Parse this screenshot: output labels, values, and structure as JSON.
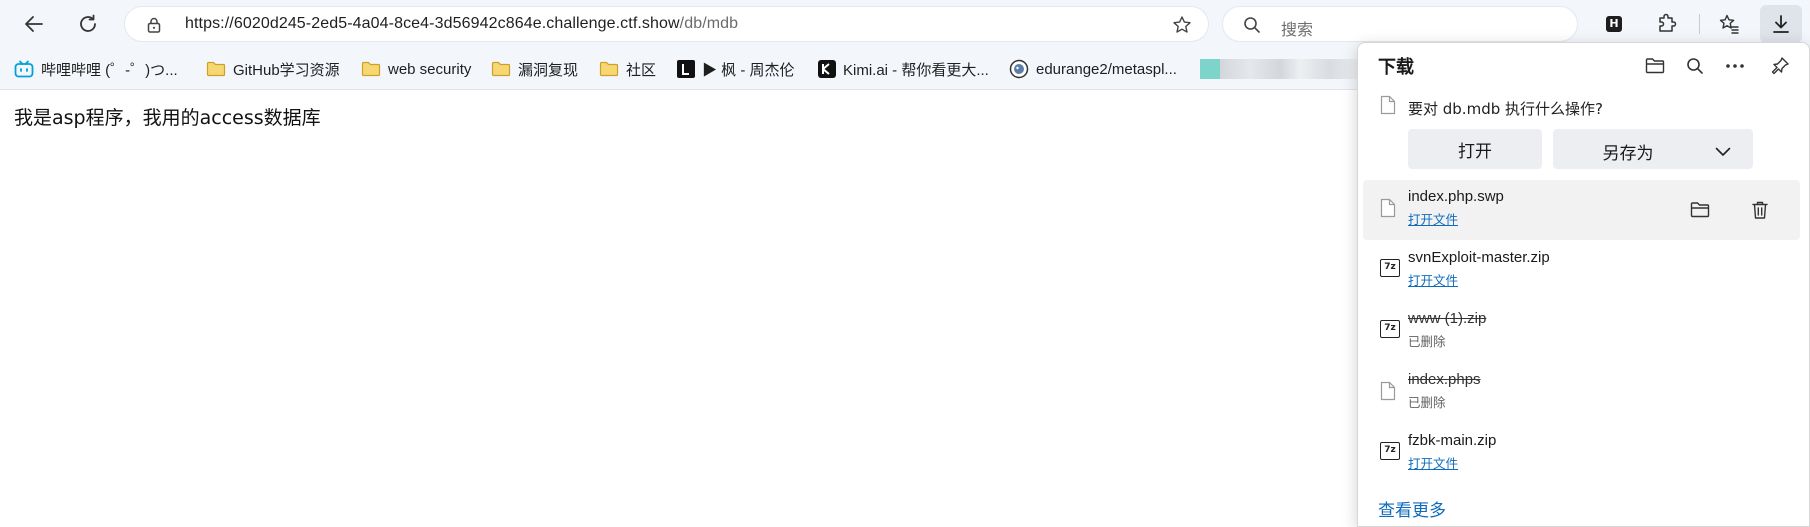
{
  "toolbar": {
    "url_main": "https://6020d245-2ed5-4a04-8ce4-3d56942c864e.challenge.ctf.show",
    "url_path": "/db/mdb",
    "search_placeholder": "搜索",
    "ext_h_label": "H"
  },
  "bookmarks": [
    {
      "label": "哔哩哔哩 (゜-゜)つ...",
      "icon": "bilibili-icon"
    },
    {
      "label": "GitHub学习资源",
      "icon": "folder-icon"
    },
    {
      "label": "web security",
      "icon": "folder-icon"
    },
    {
      "label": "漏洞复现",
      "icon": "folder-icon"
    },
    {
      "label": "社区",
      "icon": "folder-icon"
    },
    {
      "label": "▶ 枫 - 周杰伦",
      "icon": "music-app-icon"
    },
    {
      "label": "Kimi.ai - 帮你看更大...",
      "icon": "kimi-icon"
    },
    {
      "label": "edurange2/metaspl...",
      "icon": "github-icon"
    }
  ],
  "page": {
    "text": "我是asp程序，我用的access数据库"
  },
  "downloads": {
    "title": "下载",
    "prompt": "要对 db.mdb 执行什么操作?",
    "open_label": "打开",
    "saveas_label": "另存为",
    "items": [
      {
        "name": "index.php.swp",
        "status": "打开文件",
        "deleted": false,
        "type": "file"
      },
      {
        "name": "svnExploit-master.zip",
        "status": "打开文件",
        "deleted": false,
        "type": "7z"
      },
      {
        "name": "www (1).zip",
        "status": "已删除",
        "deleted": true,
        "type": "7z"
      },
      {
        "name": "index.phps",
        "status": "已删除",
        "deleted": true,
        "type": "file"
      },
      {
        "name": "fzbk-main.zip",
        "status": "打开文件",
        "deleted": false,
        "type": "7z"
      }
    ],
    "see_more": "查看更多",
    "zip_badge": "7z"
  },
  "colors": {
    "link": "#0f6cbd",
    "toolbar_bg": "#f3f6fb"
  }
}
